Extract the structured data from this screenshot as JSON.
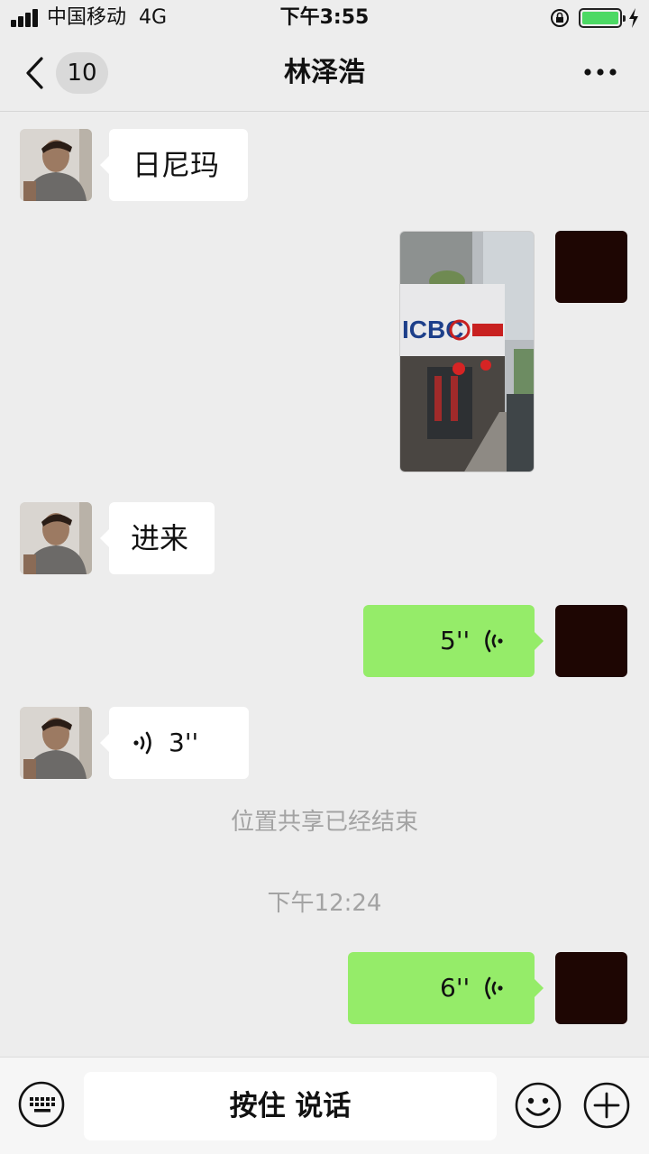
{
  "status_bar": {
    "carrier": "中国移动",
    "network": "4G",
    "time": "下午3:55",
    "battery_color": "#4cd964"
  },
  "header": {
    "unread_count": "10",
    "title": "林泽浩",
    "icons": [
      "back-chevron-icon",
      "more-dots-icon"
    ]
  },
  "messages": [
    {
      "side": "left",
      "type": "text",
      "text": "日尼玛"
    },
    {
      "side": "right",
      "type": "image",
      "image_text": "ICBC"
    },
    {
      "side": "left",
      "type": "text",
      "text": "进来"
    },
    {
      "side": "right",
      "type": "voice",
      "duration": "5''"
    },
    {
      "side": "left",
      "type": "voice",
      "duration": "3''"
    },
    {
      "type": "system",
      "text": "位置共享已经结束"
    },
    {
      "type": "timestamp",
      "text": "下午12:24"
    },
    {
      "side": "right",
      "type": "voice",
      "duration": "6''"
    }
  ],
  "input_bar": {
    "hold_to_talk": "按住 说话",
    "icons": [
      "keyboard-icon",
      "emoji-icon",
      "plus-icon"
    ]
  },
  "colors": {
    "background": "#ededed",
    "outgoing_bubble": "#95ec69",
    "incoming_bubble": "#ffffff"
  }
}
